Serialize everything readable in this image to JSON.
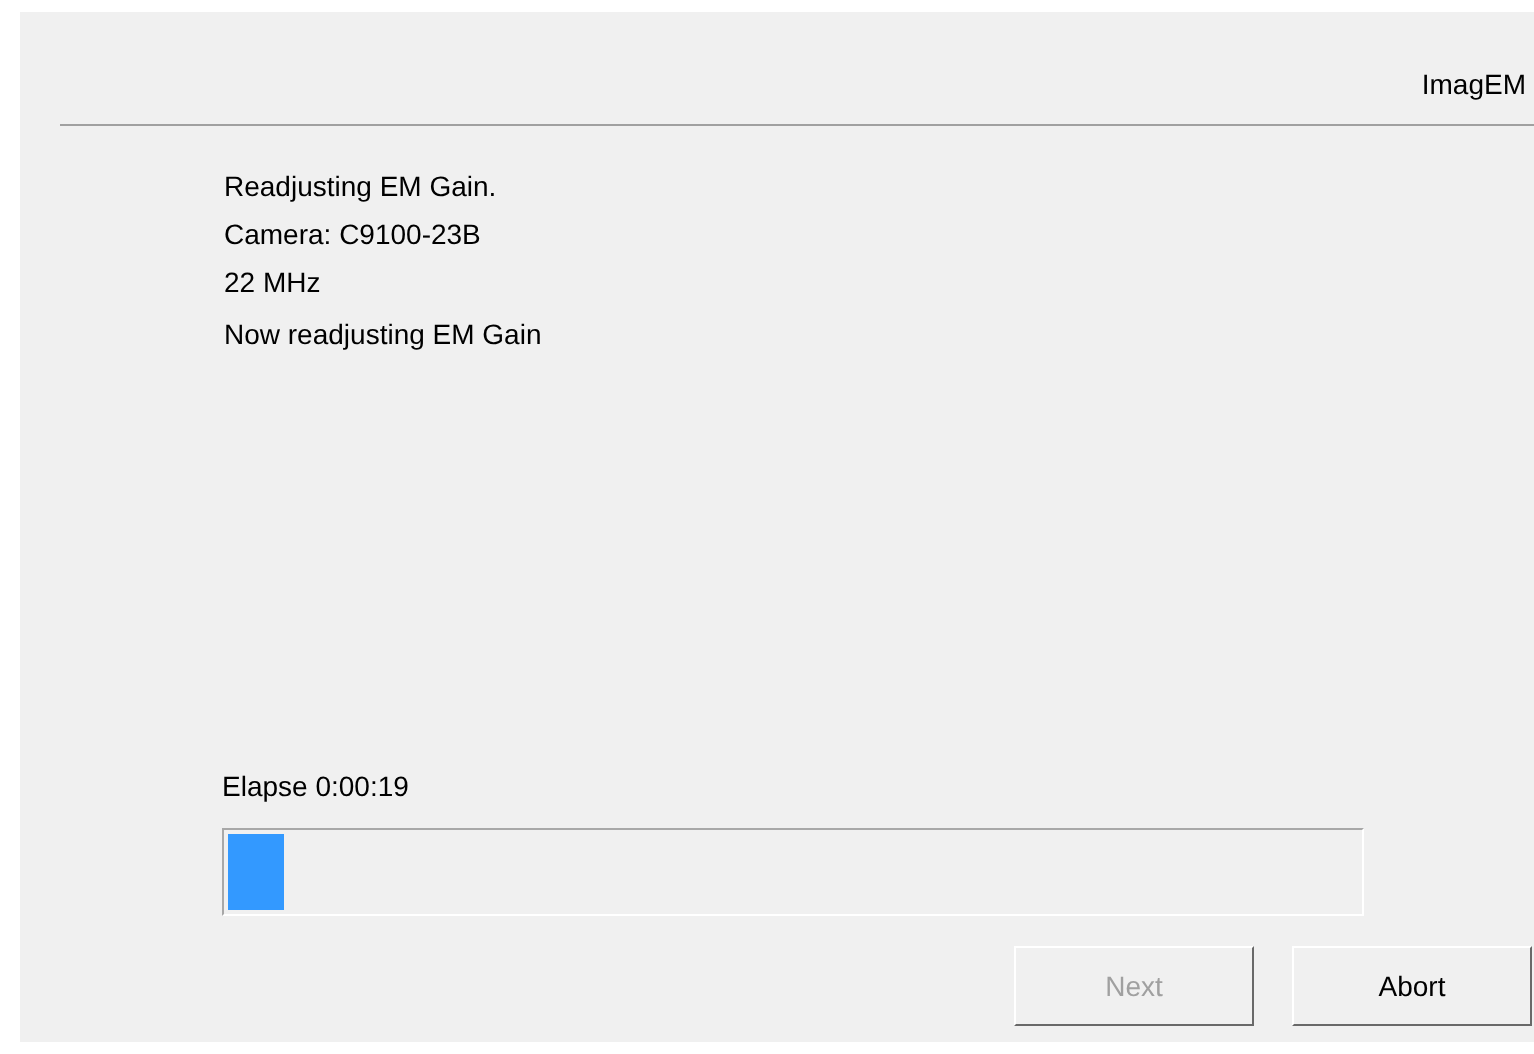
{
  "header": {
    "title": "ImagEM"
  },
  "messages": [
    "Readjusting EM Gain.",
    "Camera: C9100-23B",
    "22 MHz"
  ],
  "status": "Now readjusting EM Gain",
  "elapsed": "Elapse 0:00:19",
  "progress": {
    "level": 0.05
  },
  "buttons": [
    {
      "label": "Next",
      "disabled": true
    },
    {
      "label": "Abort",
      "disabled": false
    }
  ]
}
